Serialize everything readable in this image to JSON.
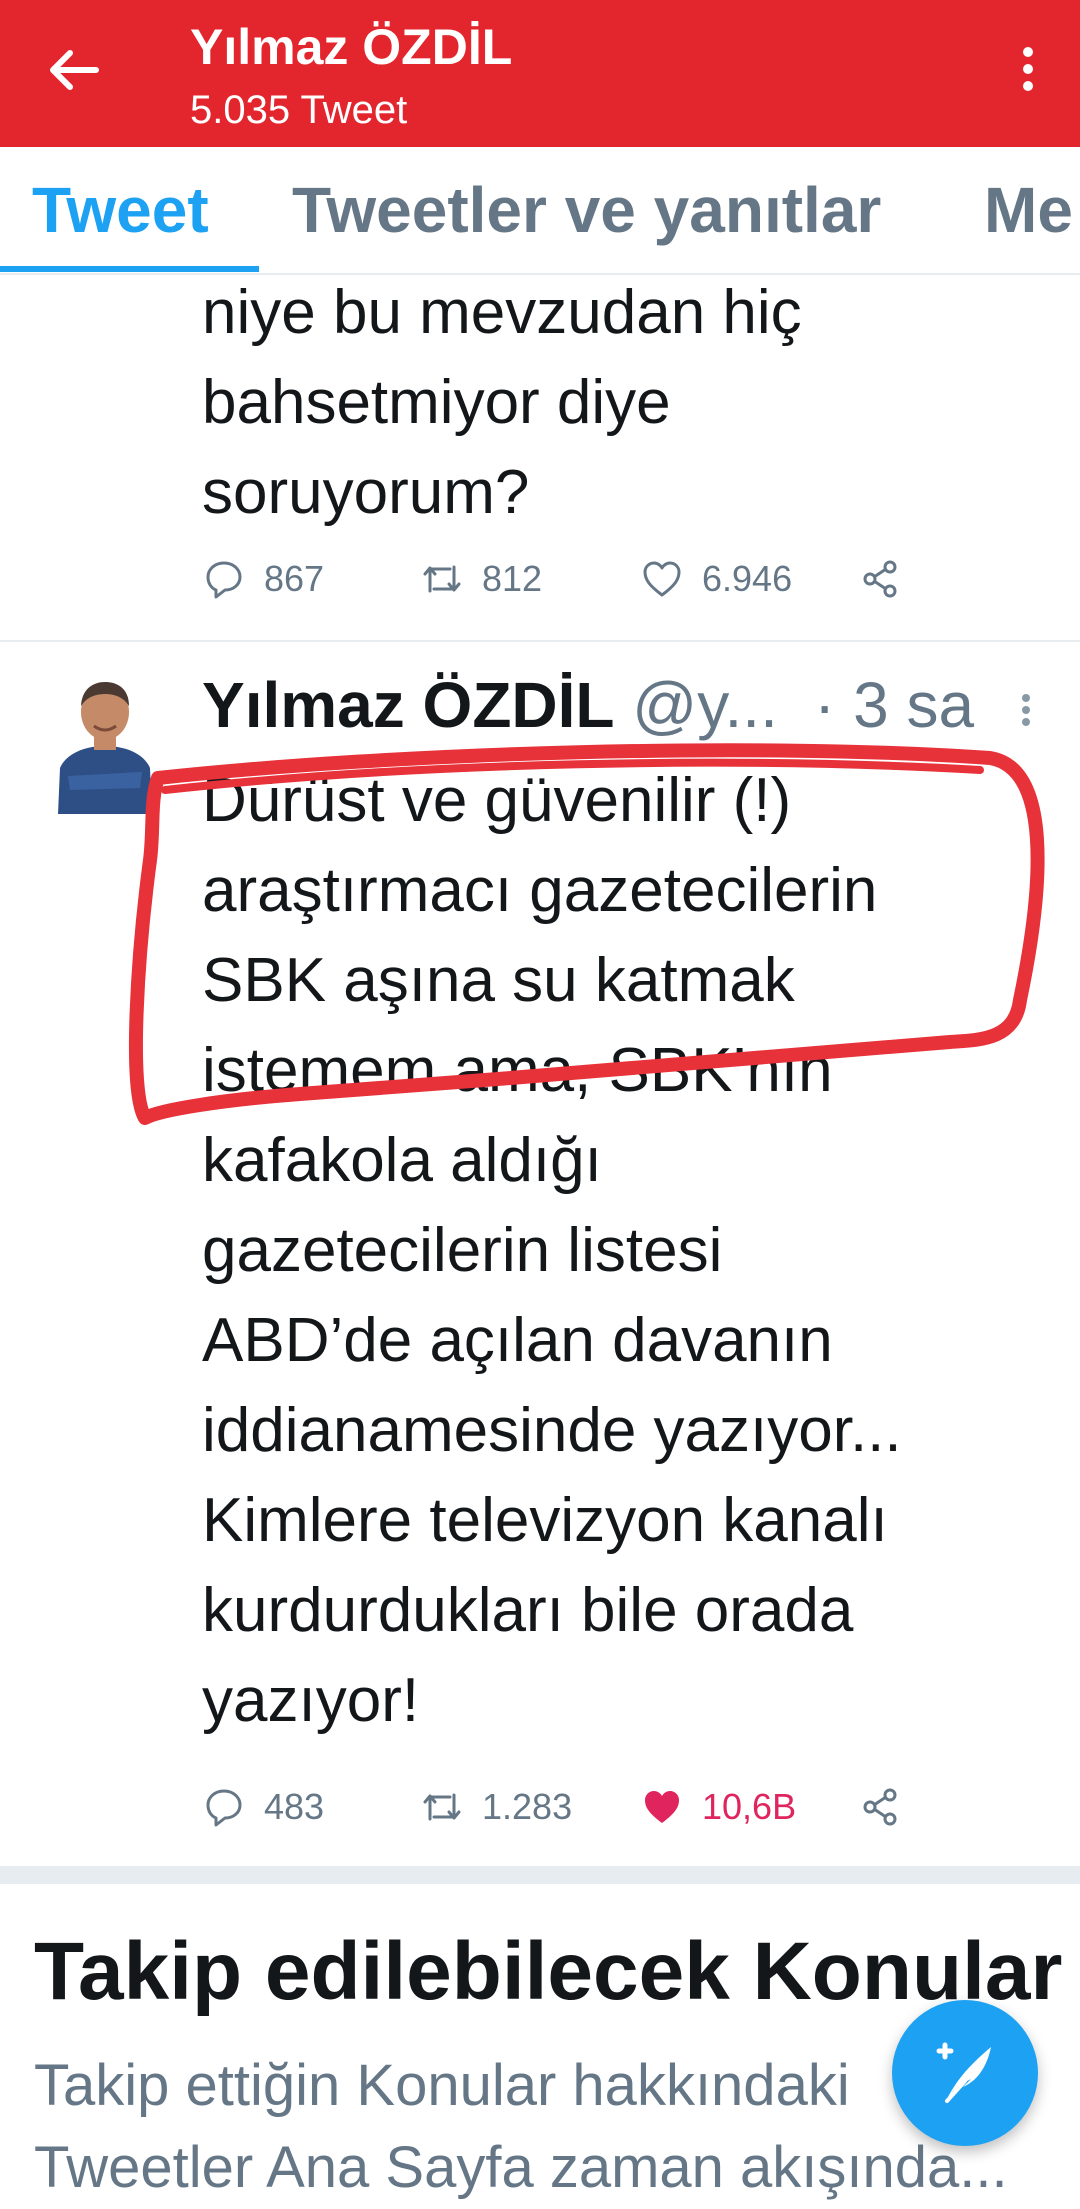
{
  "header": {
    "title": "Yılmaz ÖZDİL",
    "subtitle": "5.035 Tweet",
    "background": "#e3262d",
    "back_icon": "arrow-left-icon",
    "more_icon": "more-vertical-icon"
  },
  "tabs": [
    {
      "label": "Tweet",
      "active": true
    },
    {
      "label": "Tweetler ve yanıtlar",
      "active": false
    },
    {
      "label": "Me",
      "active": false
    }
  ],
  "tweet1": {
    "lines": [
      "niye bu mevzudan hiç",
      "bahsetmiyor diye",
      "soruyorum?"
    ],
    "replies": "867",
    "retweets": "812",
    "likes": "6.946"
  },
  "tweet2": {
    "name": "Yılmaz ÖZDİL",
    "handle": "@y...",
    "time": "· 3 sa",
    "lines": [
      "Dürüst ve güvenilir (!)",
      "araştırmacı gazetecilerin",
      "SBK aşına su katmak",
      "istemem ama, SBK’nın",
      "kafakola aldığı",
      "gazetecilerin listesi",
      "ABD’de açılan davanın",
      "iddianamesinde yazıyor...",
      "Kimlere televizyon kanalı",
      "kurdurdukları bile orada",
      "yazıyor!"
    ],
    "replies": "483",
    "retweets": "1.283",
    "likes": "10,6B",
    "liked": true,
    "annotation_color": "#e8323a"
  },
  "topics": {
    "title": "Takip edilebilecek Konular",
    "subtitle_lines": [
      "Takip ettiğin Konular hakkındaki",
      "Tweetler Ana Sayfa zaman akışında..."
    ]
  },
  "fab": {
    "icon": "compose-tweet-icon",
    "color": "#1da1f2"
  },
  "colors": {
    "accent": "#1da1f2",
    "muted": "#657786",
    "like": "#e0245e"
  }
}
